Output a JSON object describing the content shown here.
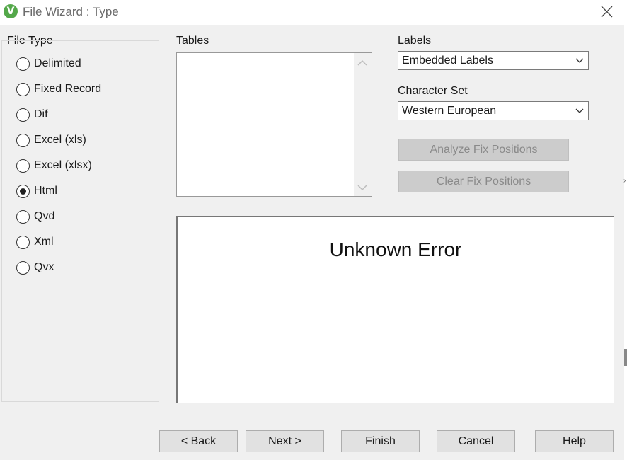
{
  "window": {
    "title": "File Wizard : Type",
    "app_icon_letter": "V",
    "app_icon_color": "#54a84a"
  },
  "file_type": {
    "label": "File Type",
    "options": [
      {
        "label": "Delimited",
        "selected": false
      },
      {
        "label": "Fixed Record",
        "selected": false
      },
      {
        "label": "Dif",
        "selected": false
      },
      {
        "label": "Excel (xls)",
        "selected": false
      },
      {
        "label": "Excel (xlsx)",
        "selected": false
      },
      {
        "label": "Html",
        "selected": true
      },
      {
        "label": "Qvd",
        "selected": false
      },
      {
        "label": "Xml",
        "selected": false
      },
      {
        "label": "Qvx",
        "selected": false
      }
    ]
  },
  "tables": {
    "label": "Tables"
  },
  "labels": {
    "label": "Labels",
    "value": "Embedded Labels"
  },
  "character_set": {
    "label": "Character Set",
    "value": "Western European"
  },
  "buttons": {
    "analyze_fix": "Analyze Fix Positions",
    "clear_fix": "Clear Fix Positions",
    "back": "< Back",
    "next": "Next >",
    "finish": "Finish",
    "cancel": "Cancel",
    "help": "Help"
  },
  "preview": {
    "message": "Unknown Error"
  }
}
